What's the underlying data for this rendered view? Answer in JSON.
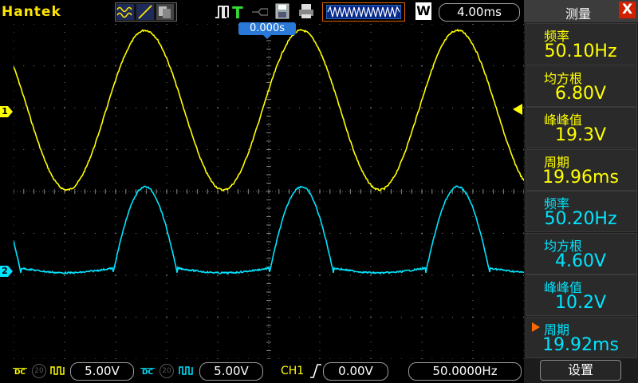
{
  "app": {
    "brand": "Hantek"
  },
  "toolbar": {
    "timebase": "4.00ms",
    "window_mode": "W",
    "trigger_status_icon": "trigger-t-icon"
  },
  "plot": {
    "trigger_time_position": "0.000s",
    "channel_1_label": "1",
    "channel_2_label": "2",
    "colors": {
      "ch1": "#ffff00",
      "ch2": "#00e5ff",
      "grid": "#808080",
      "bg": "#000000"
    }
  },
  "bottom": {
    "ch1_coupling": "DC",
    "ch1_bw": "20",
    "ch1_scale": "5.00V",
    "ch2_coupling": "DC",
    "ch2_bw": "20",
    "ch2_scale": "5.00V",
    "trigger_source": "CH1",
    "trigger_level": "0.00V",
    "trigger_frequency": "50.0000Hz"
  },
  "panel": {
    "title": "测量",
    "close": "X",
    "measurements": [
      {
        "label": "频率",
        "value": "50.10Hz",
        "channel": "ch1"
      },
      {
        "label": "均方根",
        "value": "6.80V",
        "channel": "ch1"
      },
      {
        "label": "峰峰值",
        "value": "19.3V",
        "channel": "ch1"
      },
      {
        "label": "周期",
        "value": "19.96ms",
        "channel": "ch1"
      },
      {
        "label": "频率",
        "value": "50.20Hz",
        "channel": "ch2"
      },
      {
        "label": "均方根",
        "value": "4.60V",
        "channel": "ch2"
      },
      {
        "label": "峰峰值",
        "value": "10.2V",
        "channel": "ch2"
      },
      {
        "label": "周期",
        "value": "19.92ms",
        "channel": "ch2",
        "selected": true
      }
    ],
    "settings_label": "设置"
  }
}
